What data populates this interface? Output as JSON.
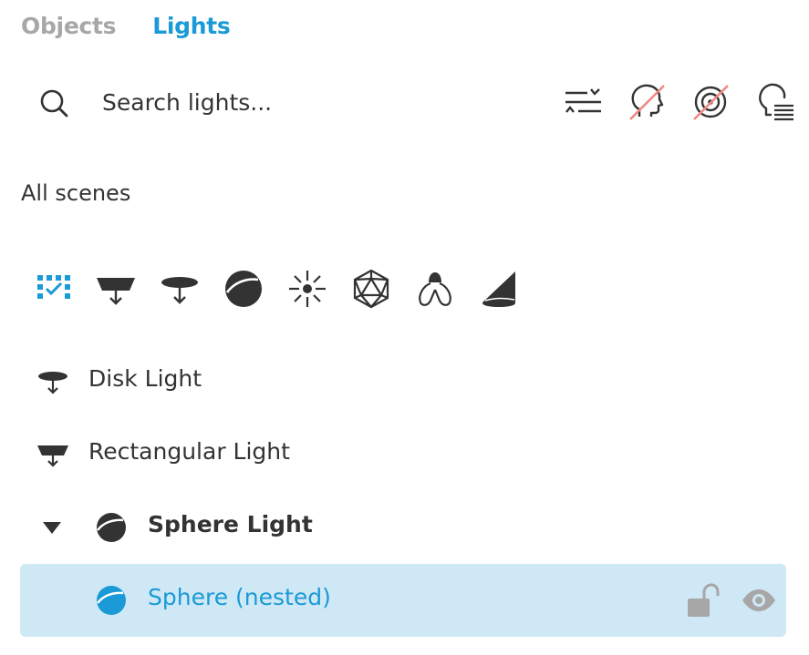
{
  "tabs": [
    {
      "label": "Objects",
      "active": false
    },
    {
      "label": "Lights",
      "active": true
    }
  ],
  "search": {
    "placeholder": "Search lights...",
    "value": ""
  },
  "toolbar": {
    "icons": [
      "filter-sort-icon",
      "hide-disabled-lights-icon",
      "hide-invisible-lights-icon",
      "light-list-icon"
    ]
  },
  "scene_selector": {
    "label": "All scenes"
  },
  "filters": {
    "items": [
      "all-types-icon",
      "rectangular-light-icon",
      "disk-light-icon",
      "sphere-light-icon",
      "point-light-icon",
      "mesh-light-icon",
      "ies-light-icon",
      "spot-light-icon"
    ],
    "selected": "all-types-icon"
  },
  "lights": [
    {
      "label": "Disk Light",
      "icon": "disk-light-icon"
    },
    {
      "label": "Rectangular Light",
      "icon": "rectangular-light-icon"
    },
    {
      "label": "Sphere Light",
      "icon": "sphere-light-icon",
      "expanded": true
    },
    {
      "label": "Sphere (nested)",
      "icon": "sphere-light-icon",
      "selected": true,
      "locked": false,
      "visible": true
    }
  ],
  "colors": {
    "accent": "#1a9ad6",
    "selected_bg": "#cfe8f5",
    "text": "#333333",
    "muted": "#a7a7a7",
    "strike": "#ef8a84"
  }
}
